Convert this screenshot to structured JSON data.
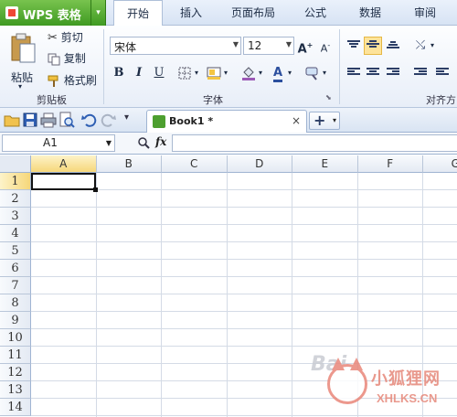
{
  "app": {
    "title": "WPS 表格"
  },
  "menu": {
    "tabs": [
      {
        "label": "开始",
        "active": true
      },
      {
        "label": "插入"
      },
      {
        "label": "页面布局"
      },
      {
        "label": "公式"
      },
      {
        "label": "数据"
      },
      {
        "label": "审阅"
      }
    ]
  },
  "ribbon": {
    "clipboard": {
      "paste": "粘贴",
      "cut": "剪切",
      "copy": "复制",
      "format_painter": "格式刷",
      "group": "剪贴板"
    },
    "font": {
      "name": "宋体",
      "size": "12",
      "bold": "B",
      "italic": "I",
      "underline": "U",
      "grow": "A",
      "shrink": "A",
      "group": "字体"
    },
    "align": {
      "group": "对齐方"
    }
  },
  "doc": {
    "tab_name": "Book1",
    "modified_mark": "*",
    "close": "×",
    "new": "+"
  },
  "formula_bar": {
    "cell_ref": "A1",
    "fx": "fx",
    "value": ""
  },
  "sheet": {
    "columns": [
      "A",
      "B",
      "C",
      "D",
      "E",
      "F",
      "G"
    ],
    "rows": [
      "1",
      "2",
      "3",
      "4",
      "5",
      "6",
      "7",
      "8",
      "9",
      "10",
      "11",
      "12",
      "13",
      "14"
    ],
    "active_cell": "A1"
  },
  "watermark": {
    "brand": "Bai",
    "cn": "小狐狸网",
    "url": "XHLKS.CN"
  }
}
